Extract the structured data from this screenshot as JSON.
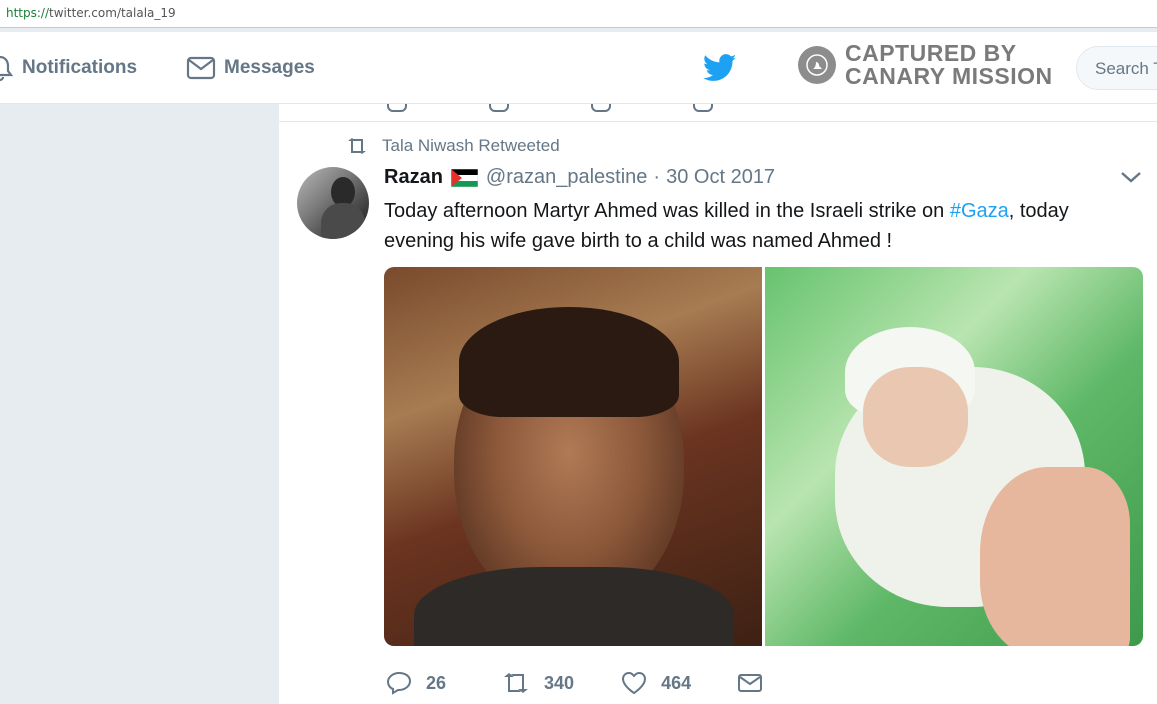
{
  "browser": {
    "url_scheme": "https://",
    "url_rest": "twitter.com/talala_19"
  },
  "nav": {
    "notifications_label": "Notifications",
    "messages_label": "Messages",
    "stamp_line1": "CAPTURED BY",
    "stamp_line2": "CANARY MISSION",
    "search_placeholder": "Search T"
  },
  "tweet": {
    "retweeted_by": "Tala Niwash Retweeted",
    "display_name": "Razan",
    "handle": "@razan_palestine",
    "separator": "·",
    "date": "30 Oct 2017",
    "text_before": "Today afternoon Martyr Ahmed was killed in the Israeli strike on ",
    "hashtag": "#Gaza",
    "text_after": ", today evening his wife gave birth to a child was named Ahmed !",
    "replies": "26",
    "retweets": "340",
    "likes": "464"
  },
  "colors": {
    "accent": "#1da1f2",
    "muted": "#657786",
    "text": "#14171a",
    "background": "#e6ecf0",
    "url_green": "#1a7f37"
  },
  "icons": [
    "bell-icon",
    "envelope-icon",
    "twitter-bird-icon",
    "canary-mission-badge",
    "retweet-icon",
    "chevron-down-icon",
    "reply-icon",
    "heart-icon",
    "direct-message-icon"
  ]
}
